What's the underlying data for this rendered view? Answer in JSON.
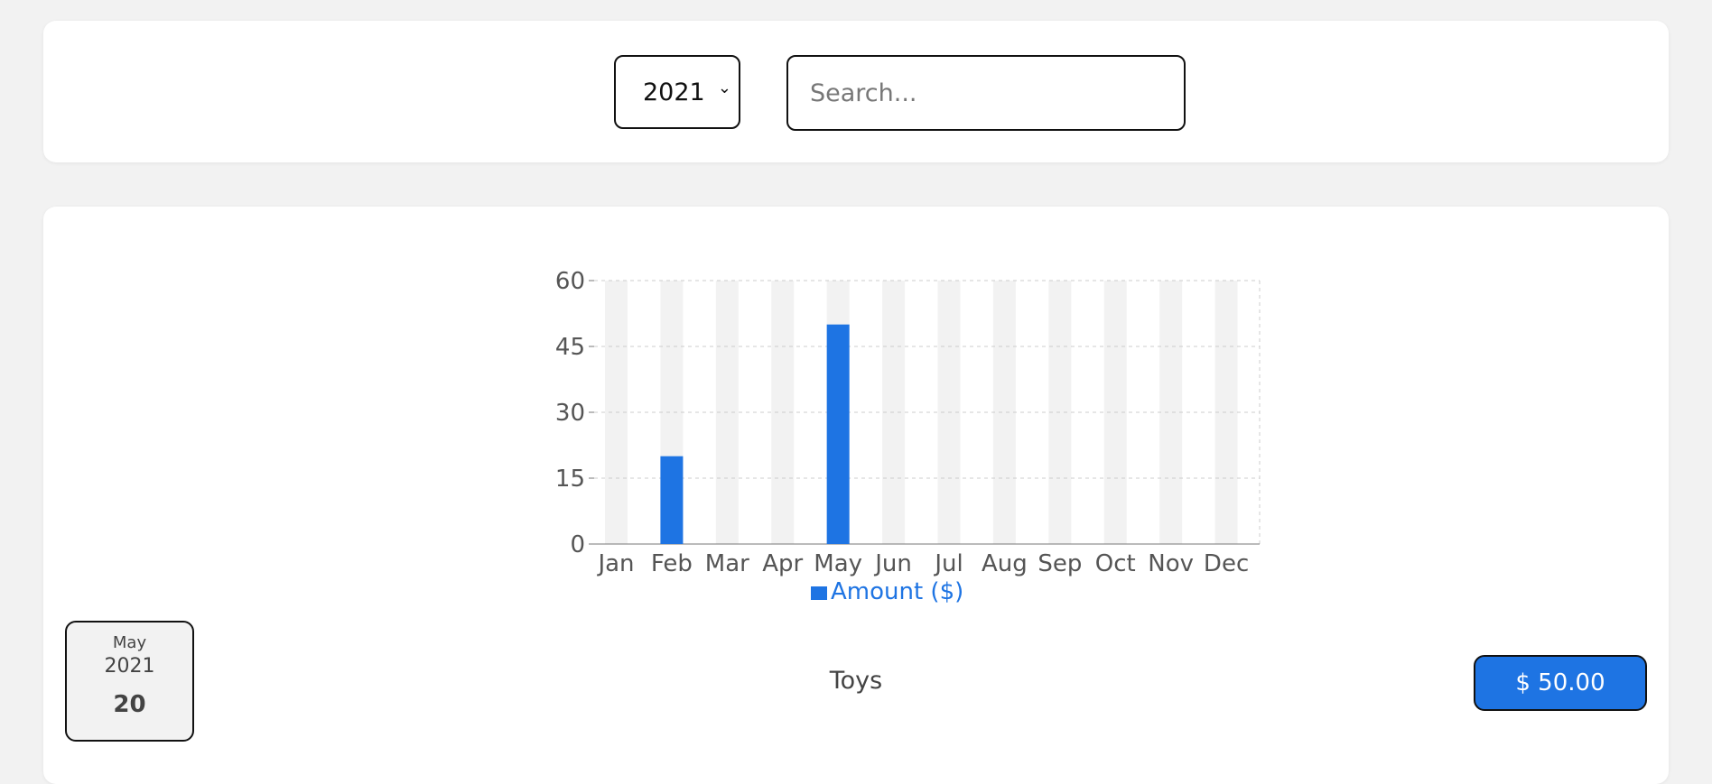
{
  "filter": {
    "year_selected": "2021",
    "search_placeholder": "Search..."
  },
  "chart_data": {
    "type": "bar",
    "categories": [
      "Jan",
      "Feb",
      "Mar",
      "Apr",
      "May",
      "Jun",
      "Jul",
      "Aug",
      "Sep",
      "Oct",
      "Nov",
      "Dec"
    ],
    "series": [
      {
        "name": "Amount ($)",
        "values": [
          0,
          20,
          0,
          0,
          50,
          0,
          0,
          0,
          0,
          0,
          0,
          0
        ]
      }
    ],
    "yticks": [
      0,
      15,
      30,
      45,
      60
    ],
    "ylim": [
      0,
      60
    ],
    "grid": true,
    "legend_placement": "bottom",
    "bar_color": "#1e74e3",
    "background_bar_color": "#f2f2f2"
  },
  "expense": {
    "month": "May",
    "year": "2021",
    "day": "20",
    "title": "Toys",
    "amount": "$ 50.00"
  }
}
